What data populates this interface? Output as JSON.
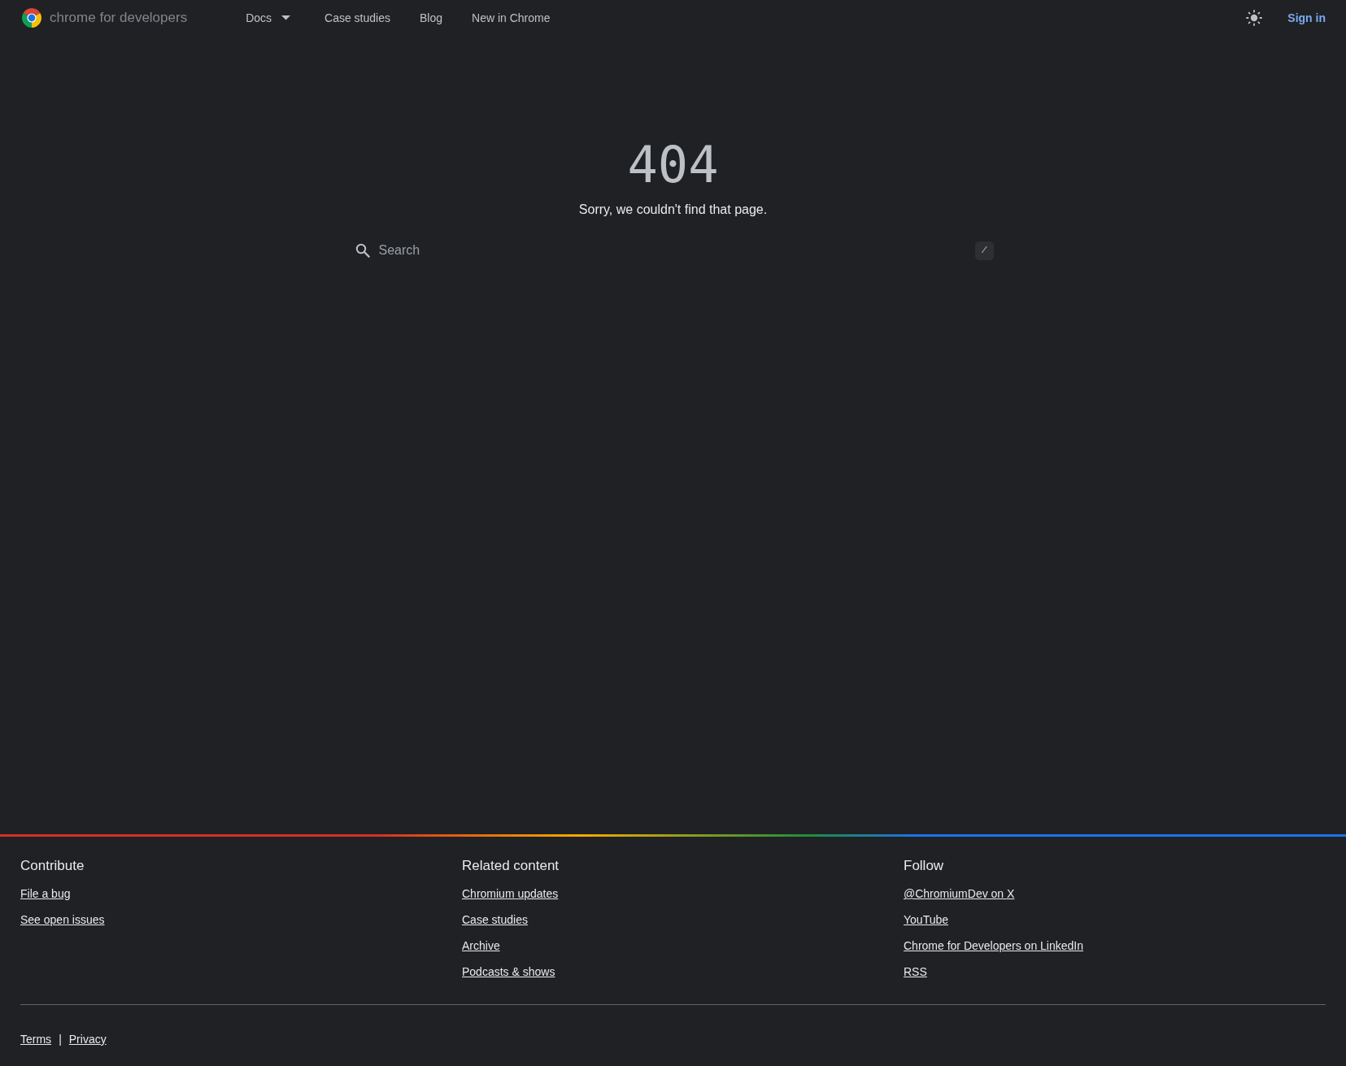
{
  "header": {
    "brand": "chrome for developers",
    "nav": [
      {
        "label": "Docs",
        "dropdown": true
      },
      {
        "label": "Case studies",
        "dropdown": false
      },
      {
        "label": "Blog",
        "dropdown": false
      },
      {
        "label": "New in Chrome",
        "dropdown": false
      }
    ],
    "sign_in": "Sign in"
  },
  "error": {
    "code": "404",
    "message": "Sorry, we couldn't find that page."
  },
  "search": {
    "placeholder": "Search",
    "shortcut": "/"
  },
  "footer": {
    "columns": [
      {
        "heading": "Contribute",
        "links": [
          "File a bug",
          "See open issues"
        ]
      },
      {
        "heading": "Related content",
        "links": [
          "Chromium updates",
          "Case studies",
          "Archive",
          "Podcasts & shows"
        ]
      },
      {
        "heading": "Follow",
        "links": [
          "@ChromiumDev on X",
          "YouTube",
          "Chrome for Developers on LinkedIn",
          "RSS"
        ]
      }
    ],
    "legal": [
      "Terms",
      "Privacy"
    ],
    "separator": "|"
  }
}
